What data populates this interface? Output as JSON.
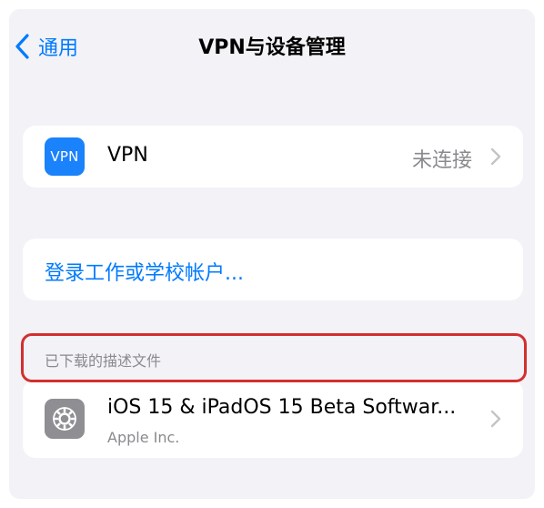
{
  "nav": {
    "back_label": "通用",
    "title": "VPN与设备管理"
  },
  "vpn_row": {
    "icon_text": "VPN",
    "label": "VPN",
    "status": "未连接"
  },
  "work_account": {
    "label": "登录工作或学校帐户..."
  },
  "profiles_section": {
    "header": "已下载的描述文件",
    "items": [
      {
        "title": "iOS 15 & iPadOS 15 Beta Softwar...",
        "subtitle": "Apple Inc.",
        "icon": "gear-icon"
      }
    ]
  },
  "colors": {
    "accent": "#007aff",
    "highlight_border": "#d32f2f",
    "background": "#f2f2f7"
  }
}
